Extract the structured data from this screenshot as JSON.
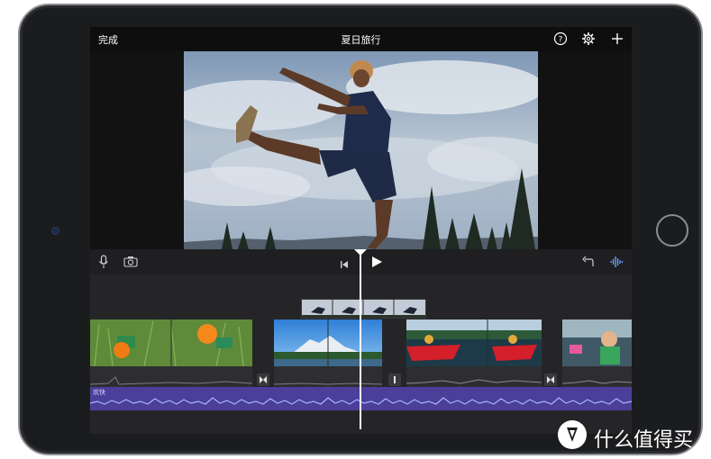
{
  "app": {
    "project_title": "夏日旅行",
    "done_label": "完成"
  },
  "toolbar_icons": [
    "help-icon",
    "settings-gear-icon",
    "add-plus-icon"
  ],
  "controls": {
    "left": [
      "microphone-icon",
      "camera-icon"
    ],
    "center": [
      "skip-to-start-icon",
      "play-icon"
    ],
    "right": [
      "undo-icon",
      "audio-waveform-icon"
    ]
  },
  "timeline": {
    "music_track_label": "欢快",
    "clips": [
      "clip-kids-frisbee",
      "clip-mountain-lake",
      "clip-red-canoe",
      "clip-kid-in-car"
    ],
    "transitions": [
      "transition-1",
      "transition-2",
      "transition-3"
    ]
  },
  "watermark": {
    "text": "什么值得买"
  },
  "colors": {
    "music_track": "#4b3f9a",
    "timeline_bg": "#252527",
    "waveform": "#a9b6ff"
  }
}
